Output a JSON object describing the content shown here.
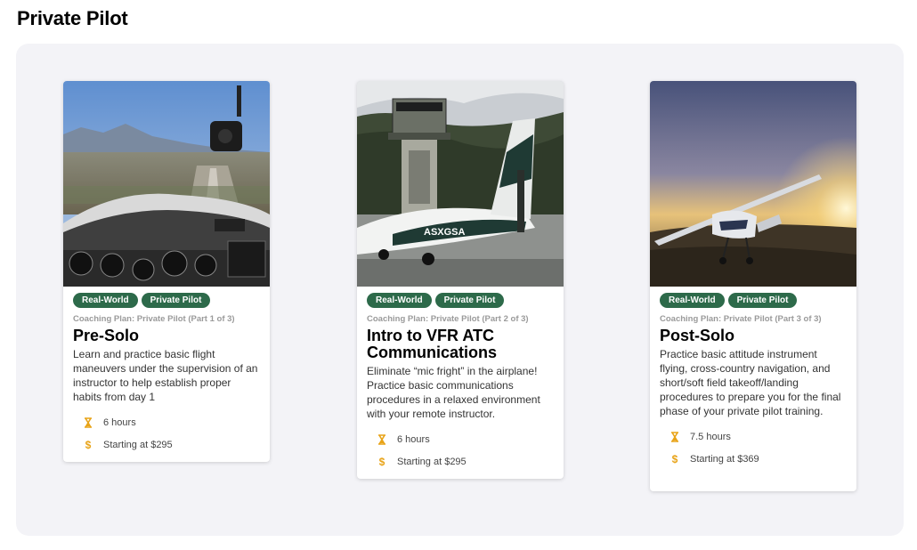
{
  "page": {
    "title": "Private Pilot"
  },
  "colors": {
    "tag_bg": "#2d6a4a",
    "icon_accent": "#e8a317",
    "panel_bg": "#f3f3f7"
  },
  "cards": [
    {
      "image": "cockpit-view-landing-image",
      "tags": [
        "Real-World",
        "Private Pilot"
      ],
      "plan": "Coaching Plan: Private Pilot (Part 1 of 3)",
      "title": "Pre-Solo",
      "description": "Learn and practice basic flight maneuvers under the supervision of an instructor to help establish proper habits from day 1",
      "duration": "6 hours",
      "price": "Starting at $295"
    },
    {
      "image": "control-tower-aircraft-image",
      "tags": [
        "Real-World",
        "Private Pilot"
      ],
      "plan": "Coaching Plan: Private Pilot (Part 2 of 3)",
      "title": "Intro to VFR ATC Communications",
      "description": "Eliminate “mic fright” in the airplane! Practice basic communications procedures in a relaxed environment with your remote instructor.",
      "duration": "6 hours",
      "price": "Starting at $295",
      "tail": "ASXGSA"
    },
    {
      "image": "plane-sunset-image",
      "tags": [
        "Real-World",
        "Private Pilot"
      ],
      "plan": "Coaching Plan: Private Pilot (Part 3 of 3)",
      "title": "Post-Solo",
      "description": "Practice basic attitude instrument flying, cross-country navigation, and short/soft field takeoff/landing procedures to prepare you for the final phase of your private pilot training.",
      "duration": "7.5 hours",
      "price": "Starting at $369"
    }
  ],
  "icons": {
    "duration": "hourglass-icon",
    "price": "dollar-icon"
  }
}
